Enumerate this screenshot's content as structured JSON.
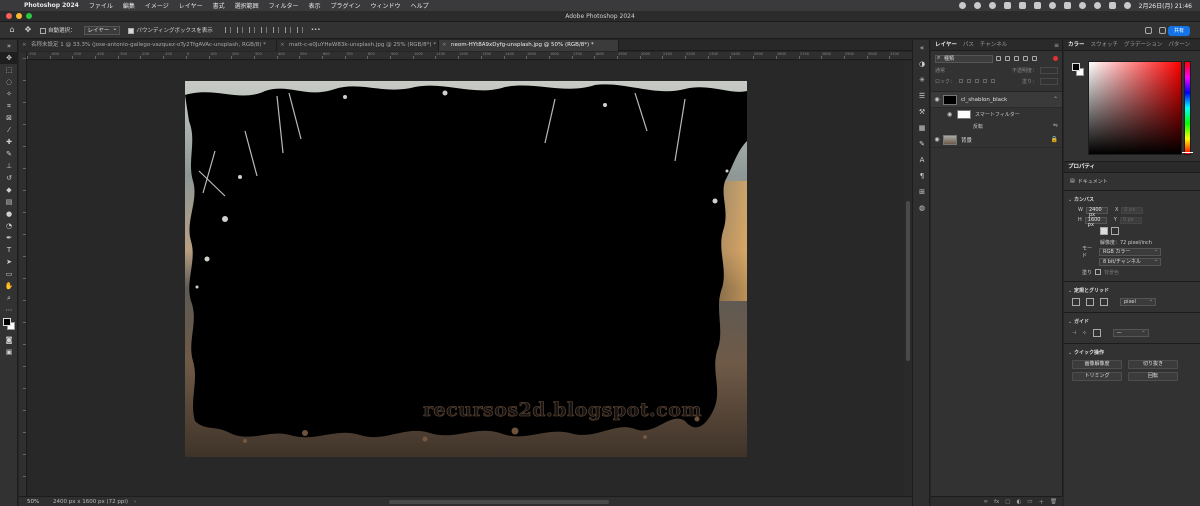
{
  "menubar": {
    "app": "Photoshop 2024",
    "items": [
      "ファイル",
      "編集",
      "イメージ",
      "レイヤー",
      "書式",
      "選択範囲",
      "フィルター",
      "表示",
      "プラグイン",
      "ウィンドウ",
      "ヘルプ"
    ],
    "clock": "2月26日(月) 21:46"
  },
  "window": {
    "title": "Adobe Photoshop 2024"
  },
  "options": {
    "auto_select_label": "自動選択：",
    "auto_select_value": "レイヤー",
    "bounding_box_label": "バウンディングボックスを表示",
    "more": "•••",
    "share_label": "共有"
  },
  "tabs": [
    {
      "label": "名称未設定 1 @ 33.3% (jose-antonio-gallego-vazquez-oTy2TfgAVAc-unsplash, RGB/8) *"
    },
    {
      "label": "matt-c-e0JuYHeW83k-unsplash.jpg @ 25% (RGB/8*) *"
    },
    {
      "label": "neom-HYt8A9xDyfg-unsplash.jpg @ 50% (RGB/8*) *"
    }
  ],
  "ruler_labels": [
    "-700",
    "-600",
    "-500",
    "-400",
    "-300",
    "-200",
    "-100",
    "0",
    "100",
    "200",
    "300",
    "400",
    "500",
    "600",
    "700",
    "800",
    "900",
    "1000",
    "1100",
    "1200",
    "1300",
    "1400",
    "1500",
    "1600",
    "1700",
    "1800",
    "1900",
    "2000",
    "2100",
    "2200",
    "2300",
    "2400",
    "2500",
    "2600",
    "2700",
    "2800",
    "2900",
    "3000",
    "3100"
  ],
  "canvas": {
    "watermark": "recursos2d.blogspot.com"
  },
  "status": {
    "zoom": "50%",
    "doc_info": "2400 px x 1600 px (72 ppi)",
    "chevron": "›"
  },
  "layers_panel": {
    "tabs": [
      "レイヤー",
      "パス",
      "チャンネル"
    ],
    "filter_label": "種類",
    "blend_mode": "通常",
    "opacity_label": "不透明度：",
    "lock_label": "ロック：",
    "fill_label": "塗り：",
    "layers": [
      {
        "name": "cl_shablon_black",
        "thumb_color": "#000000"
      },
      {
        "name": "背景",
        "thumb_color": "#7a6a55"
      }
    ],
    "smart_filter_label": "スマートフィルター",
    "invert_label": "反転",
    "footer_icons": [
      "∞",
      "fx",
      "▢",
      "◐",
      "▭",
      "＋",
      "🗑"
    ]
  },
  "color_panel": {
    "tabs": [
      "カラー",
      "スウォッチ",
      "グラデーション",
      "パターン"
    ],
    "fg_color": "#000000",
    "bg_color": "#ffffff"
  },
  "properties": {
    "tab": "プロパティ",
    "doc_label": "ドキュメント",
    "canvas_section": "カンバス",
    "width_label": "W",
    "width": "2400 px",
    "height_label": "H",
    "height": "1600 px",
    "x_label": "X",
    "x_placeholder": "0 px",
    "y_label": "Y",
    "y_placeholder": "0 px",
    "resolution": "解像度：72 pixel/inch",
    "mode_label": "モード",
    "mode": "RGB カラー",
    "bits": "8 bit/チャンネル",
    "fill_label": "塗り",
    "fill_value": "背景色",
    "rulers_section": "定規とグリッド",
    "units": "pixel",
    "guides_section": "ガイド",
    "quick_section": "クイック操作",
    "btn_image_size": "画像解像度",
    "btn_crop": "切り抜き",
    "btn_trim": "トリミング",
    "btn_rotate": "回転"
  },
  "colors": {
    "accent": "#1473e6",
    "close": "#ff5f57",
    "minimize": "#febc2e",
    "zoom": "#28c840"
  }
}
